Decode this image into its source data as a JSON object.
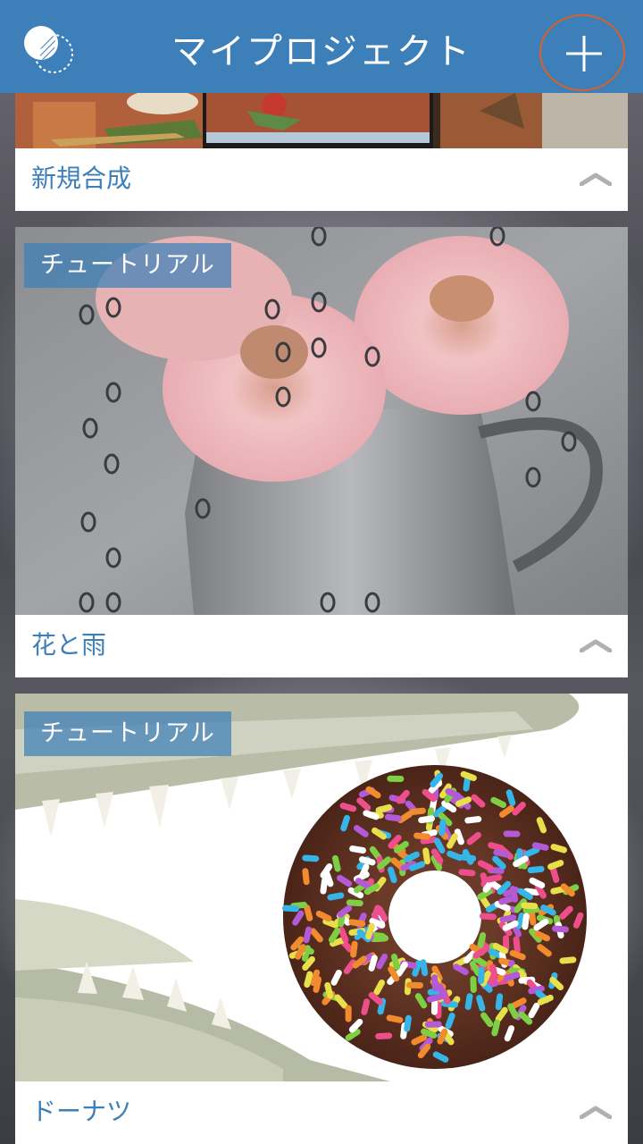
{
  "header": {
    "title": "マイプロジェクト",
    "accent_color": "#3d7fb8",
    "highlight_color": "#d8602a",
    "logo_icon": "app-logo-icon",
    "add_icon": "plus-icon"
  },
  "projects": [
    {
      "label": "新規合成",
      "badge": "",
      "expand_icon": "chevron-up-icon"
    },
    {
      "label": "花と雨",
      "badge": "チュートリアル",
      "expand_icon": "chevron-up-icon"
    },
    {
      "label": "ドーナツ",
      "badge": "チュートリアル",
      "expand_icon": "chevron-up-icon"
    }
  ]
}
